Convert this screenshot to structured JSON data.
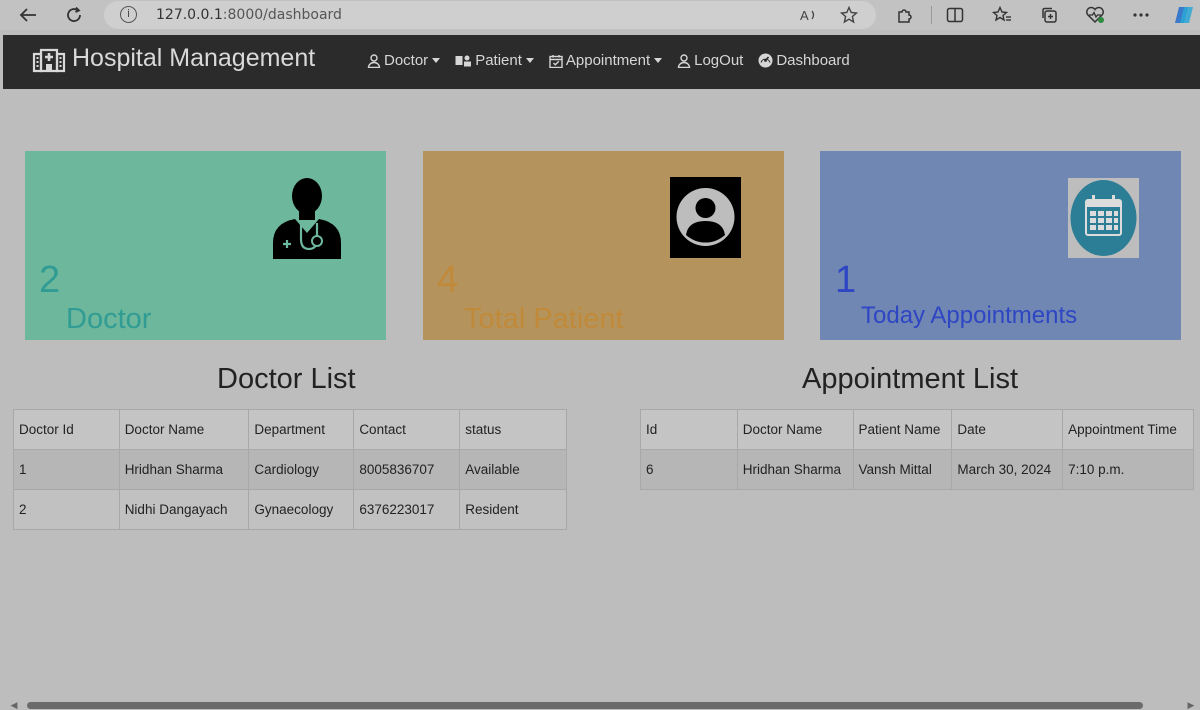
{
  "browser": {
    "url_host": "127.0.0.1",
    "url_path": ":8000/dashboard",
    "icons": [
      "back-icon",
      "refresh-icon",
      "info-icon",
      "read-aloud-icon",
      "favorite-star-icon",
      "extensions-icon",
      "split-screen-icon",
      "favorites-icon",
      "collections-icon",
      "health-icon",
      "more-icon",
      "copilot-icon"
    ]
  },
  "navbar": {
    "brand": "Hospital Management",
    "items": [
      {
        "label": "Doctor",
        "icon": "doctor-icon",
        "dropdown": true
      },
      {
        "label": "Patient",
        "icon": "patient-icon",
        "dropdown": true
      },
      {
        "label": "Appointment",
        "icon": "calendar-check-icon",
        "dropdown": true
      },
      {
        "label": "LogOut",
        "icon": "user-icon",
        "dropdown": false
      },
      {
        "label": "Dashboard",
        "icon": "dashboard-icon",
        "dropdown": false
      }
    ]
  },
  "cards": [
    {
      "count": "2",
      "label": "Doctor",
      "color": "#6db79d",
      "icon": "doctor-stethoscope-icon"
    },
    {
      "count": "4",
      "label": "Total Patient",
      "color": "#b4945c",
      "icon": "patient-avatar-icon"
    },
    {
      "count": "1",
      "label": "Today Appointments",
      "color": "#6f87b2",
      "icon": "calendar-icon"
    }
  ],
  "doctor_list": {
    "title": "Doctor List",
    "columns": [
      "Doctor Id",
      "Doctor Name",
      "Department",
      "Contact",
      "status"
    ],
    "rows": [
      [
        "1",
        "Hridhan Sharma",
        "Cardiology",
        "8005836707",
        "Available"
      ],
      [
        "2",
        "Nidhi Dangayach",
        "Gynaecology",
        "6376223017",
        "Resident"
      ]
    ]
  },
  "appointment_list": {
    "title": "Appointment List",
    "columns": [
      "Id",
      "Doctor Name",
      "Patient Name",
      "Date",
      "Appointment Time"
    ],
    "rows": [
      [
        "6",
        "Hridhan Sharma",
        "Vansh Mittal",
        "March 30, 2024",
        "7:10 p.m."
      ]
    ]
  }
}
